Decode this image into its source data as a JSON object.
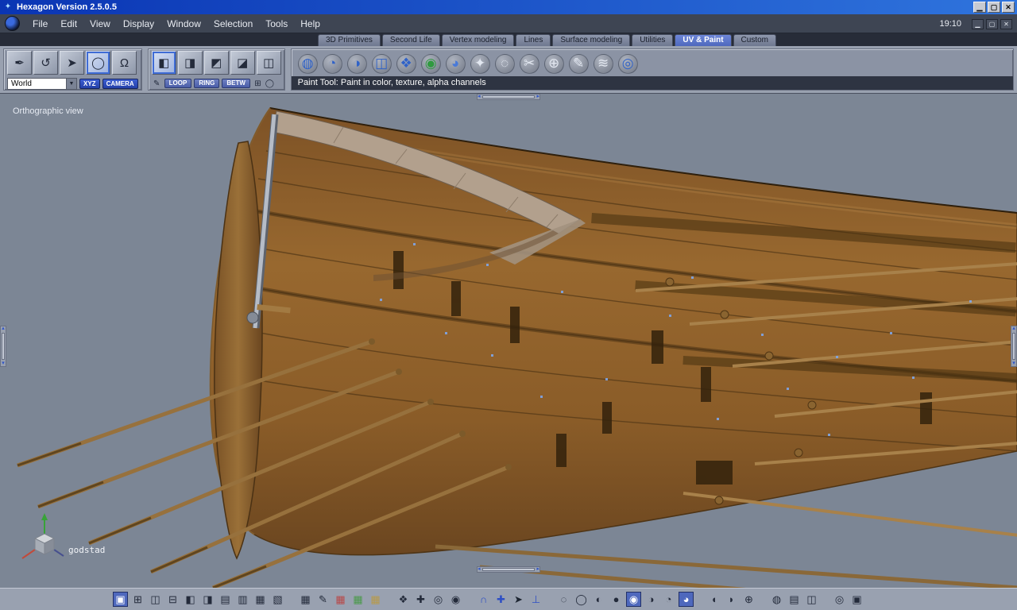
{
  "window": {
    "title": "Hexagon Version 2.5.0.5",
    "title_icon_glyph": "✦",
    "controls": [
      {
        "name": "window-minimize-button",
        "glyph": "▁"
      },
      {
        "name": "window-restore-button",
        "glyph": "▢"
      },
      {
        "name": "window-close-button",
        "glyph": "✕"
      }
    ]
  },
  "menubar": {
    "items": [
      {
        "name": "menu-file",
        "label": "File"
      },
      {
        "name": "menu-edit",
        "label": "Edit"
      },
      {
        "name": "menu-view",
        "label": "View"
      },
      {
        "name": "menu-display",
        "label": "Display"
      },
      {
        "name": "menu-window",
        "label": "Window"
      },
      {
        "name": "menu-selection",
        "label": "Selection"
      },
      {
        "name": "menu-tools",
        "label": "Tools"
      },
      {
        "name": "menu-help",
        "label": "Help"
      }
    ],
    "clock": "19:10",
    "window_buttons": [
      {
        "name": "mdi-minimize-button",
        "glyph": "▁"
      },
      {
        "name": "mdi-restore-button",
        "glyph": "▢"
      },
      {
        "name": "mdi-close-button",
        "glyph": "✕"
      }
    ]
  },
  "tabs": {
    "items": [
      {
        "name": "tab-3d-primitives",
        "label": "3D Primitives"
      },
      {
        "name": "tab-second-life",
        "label": "Second Life"
      },
      {
        "name": "tab-vertex-modeling",
        "label": "Vertex modeling"
      },
      {
        "name": "tab-lines",
        "label": "Lines"
      },
      {
        "name": "tab-surface-modeling",
        "label": "Surface modeling"
      },
      {
        "name": "tab-utilities",
        "label": "Utilities"
      },
      {
        "name": "tab-uv-paint",
        "label": "UV & Paint",
        "active": true
      },
      {
        "name": "tab-custom",
        "label": "Custom"
      }
    ]
  },
  "toolbar": {
    "select_tools": [
      {
        "name": "knife-tool-icon",
        "glyph": "✒"
      },
      {
        "name": "arc-select-tool-icon",
        "glyph": "↺"
      },
      {
        "name": "cursor-tool-icon",
        "glyph": "➤"
      },
      {
        "name": "circle-select-tool-icon",
        "glyph": "◯",
        "active": true
      },
      {
        "name": "ghost-select-tool-icon",
        "glyph": "Ω"
      }
    ],
    "world_dropdown": {
      "value": "World",
      "arrow_icon": "▼"
    },
    "xyz_button": "XYZ",
    "camera_button": "CAMERA",
    "edge_tools": [
      {
        "name": "edge-cube-icon",
        "glyph": "◧",
        "active": true
      },
      {
        "name": "loop-cube-icon",
        "glyph": "◨"
      },
      {
        "name": "ring-cube-icon",
        "glyph": "◩"
      },
      {
        "name": "between-cube-icon",
        "glyph": "◪"
      },
      {
        "name": "border-cube-icon",
        "glyph": "◫"
      }
    ],
    "edge_pen_icon": "✎",
    "loop_button": "LOOP",
    "ring_button": "RING",
    "betw_button": "BETW",
    "extra_icons": [
      {
        "name": "add-selection-icon",
        "glyph": "⊞"
      },
      {
        "name": "circle-mode-icon",
        "glyph": "◯"
      }
    ],
    "uv_paint_tools": [
      {
        "name": "uv-globe-icon",
        "glyph": "◍",
        "color": "#2f62c8"
      },
      {
        "name": "uv-checker-sphere-icon",
        "glyph": "◔",
        "color": "#2f62c8"
      },
      {
        "name": "uv-half-sphere-icon",
        "glyph": "◑",
        "color": "#2f62c8"
      },
      {
        "name": "uv-cube-projection-icon",
        "glyph": "◫",
        "color": "#2f62c8"
      },
      {
        "name": "uv-unfold-icon",
        "glyph": "❖",
        "color": "#2f62c8"
      },
      {
        "name": "paint-color-sphere-icon",
        "glyph": "◉",
        "color": "#2f9a3f"
      },
      {
        "name": "paint-displacement-icon",
        "glyph": "◕",
        "color": "#4a7ad8"
      },
      {
        "name": "uv-stretch-icon",
        "glyph": "✦",
        "color": "#e2e7f0"
      },
      {
        "name": "uv-relax-icon",
        "glyph": "◌",
        "color": "#e2e7f0"
      },
      {
        "name": "uv-cut-icon",
        "glyph": "✂",
        "color": "#e2e7f0"
      },
      {
        "name": "uv-pin-icon",
        "glyph": "⊕",
        "color": "#e2e7f0"
      },
      {
        "name": "paint-brush-icon",
        "glyph": "✎",
        "color": "#e2e7f0"
      },
      {
        "name": "paint-airbrush-icon",
        "glyph": "≋",
        "color": "#e2e7f0"
      },
      {
        "name": "bake-texture-icon",
        "glyph": "◎",
        "color": "#2f62c8"
      }
    ],
    "status_text": "Paint Tool: Paint in color, texture, alpha channels"
  },
  "viewport": {
    "view_label": "Orthographic view",
    "model_label": "godstad",
    "splitter_arrows": {
      "left": "◂",
      "right": "▸",
      "up": "▴",
      "down": "▾"
    }
  },
  "bottombar": {
    "groups": [
      {
        "name": "view-layout-group",
        "items": [
          {
            "name": "layout-single-view",
            "glyph": "▣",
            "active": true
          },
          {
            "name": "layout-four-views",
            "glyph": "⊞"
          },
          {
            "name": "layout-two-columns",
            "glyph": "◫"
          },
          {
            "name": "layout-two-rows",
            "glyph": "⊟"
          },
          {
            "name": "layout-left-split",
            "glyph": "◧"
          },
          {
            "name": "layout-right-split",
            "glyph": "◨"
          },
          {
            "name": "layout-top-split",
            "glyph": "▤"
          },
          {
            "name": "layout-bottom-split",
            "glyph": "▥"
          },
          {
            "name": "layout-grid",
            "glyph": "▦"
          },
          {
            "name": "layout-columns",
            "glyph": "▧"
          }
        ]
      },
      {
        "name": "texture-display-group",
        "items": [
          {
            "name": "uv-grid-icon",
            "glyph": "▦"
          },
          {
            "name": "eyedropper-icon",
            "glyph": "✎"
          },
          {
            "name": "texture-red-icon",
            "glyph": "▦",
            "color": "#b84848"
          },
          {
            "name": "texture-green-icon",
            "glyph": "▦",
            "color": "#4a9a4a"
          },
          {
            "name": "texture-palette-icon",
            "glyph": "▦",
            "color": "#b89a48"
          }
        ]
      },
      {
        "name": "navigation-group",
        "items": [
          {
            "name": "checkerboard-icon",
            "glyph": "❖"
          },
          {
            "name": "pan-tool-icon",
            "glyph": "✚"
          },
          {
            "name": "zoom-tool-icon",
            "glyph": "◎"
          },
          {
            "name": "visibility-eye-icon",
            "glyph": "◉"
          }
        ]
      },
      {
        "name": "snap-group",
        "items": [
          {
            "name": "magnet-snap-icon",
            "glyph": "∩",
            "color": "#2e4fc4"
          },
          {
            "name": "snap-grid-icon",
            "glyph": "✚",
            "color": "#2e4fc4"
          },
          {
            "name": "pick-move-icon",
            "glyph": "➤",
            "color": "#1c2430"
          },
          {
            "name": "align-drop-icon",
            "glyph": "⊥",
            "color": "#2e4fc4"
          }
        ]
      },
      {
        "name": "shading-group",
        "items": [
          {
            "name": "wireframe-shading-icon",
            "glyph": "◌"
          },
          {
            "name": "hiddenline-shading-icon",
            "glyph": "◯"
          },
          {
            "name": "flat-shading-icon",
            "glyph": "◐"
          },
          {
            "name": "smooth-shading-icon",
            "glyph": "●"
          },
          {
            "name": "textured-shading-icon",
            "glyph": "◉",
            "active": true
          },
          {
            "name": "shadow-shading-icon",
            "glyph": "◑"
          },
          {
            "name": "transparent-shading-icon",
            "glyph": "◔"
          },
          {
            "name": "material-shading-icon",
            "glyph": "◕",
            "active": true
          }
        ]
      },
      {
        "name": "quality-group",
        "items": [
          {
            "name": "quality-low-icon",
            "glyph": "◖"
          },
          {
            "name": "quality-medium-icon",
            "glyph": "◗"
          },
          {
            "name": "quality-high-icon",
            "glyph": "⊕"
          }
        ]
      },
      {
        "name": "scene-panels-group",
        "items": [
          {
            "name": "ghost-visibility-icon",
            "glyph": "◍"
          },
          {
            "name": "properties-panel-icon",
            "glyph": "▤"
          },
          {
            "name": "dual-view-icon",
            "glyph": "◫"
          }
        ]
      },
      {
        "name": "render-group",
        "items": [
          {
            "name": "render-preview-icon",
            "glyph": "◎"
          },
          {
            "name": "camera-capture-icon",
            "glyph": "▣"
          }
        ]
      }
    ]
  },
  "colors": {
    "titlebar_left": "#0a35b4",
    "titlebar_right": "#2f74dd",
    "menubar_bg": "#3e4553",
    "tab_active_bg": "#4e68bd",
    "toolbar_bg": "#99a1b0",
    "status_bg": "#2e3442",
    "viewport_bg": "#7c8695",
    "accent_blue": "#2f55c8",
    "wood_dark": "#6b4620",
    "wood_mid": "#98682f",
    "wood_light": "#c09050",
    "deck_tan": "#b2a08d"
  }
}
